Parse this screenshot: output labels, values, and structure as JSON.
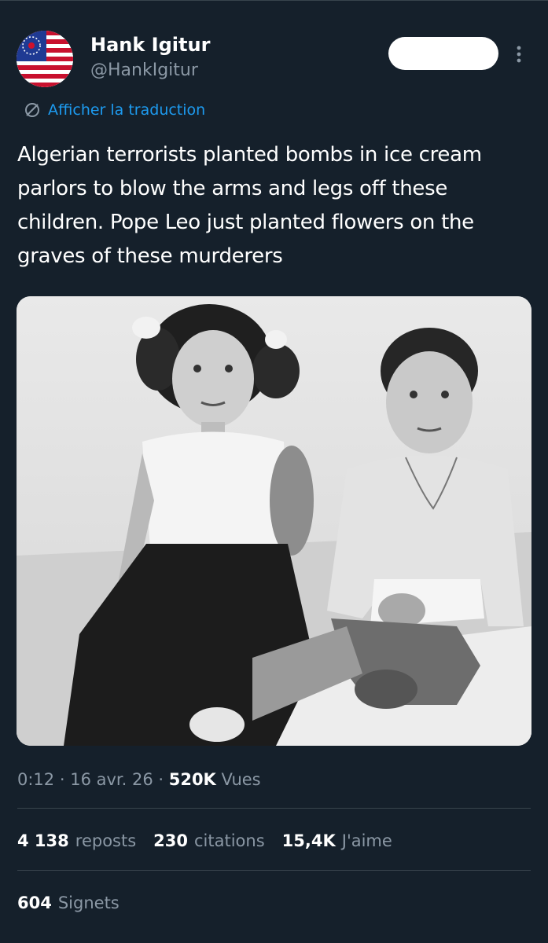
{
  "author": {
    "name": "Hank Igitur",
    "handle": "@HankIgitur"
  },
  "follow_button_label": "",
  "translate_link": "Afficher la traduction",
  "tweet_text": "Algerian terrorists planted bombs in ice cream parlors to blow the arms and legs off these children. Pope Leo just planted flowers on the graves of these murderers",
  "meta": {
    "time": "0:12",
    "separator": " · ",
    "date": "16 avr. 26",
    "views_count": "520K",
    "views_label": "Vues"
  },
  "stats": {
    "reposts": {
      "count": "4 138",
      "label": "reposts"
    },
    "quotes": {
      "count": "230",
      "label": "citations"
    },
    "likes": {
      "count": "15,4K",
      "label": "J'aime"
    }
  },
  "bookmarks": {
    "count": "604",
    "label": "Signets"
  },
  "icons": {
    "avatar": "us-flag-avatar",
    "translate": "translate-slash-circle-icon",
    "more": "more-vertical-icon"
  },
  "colors": {
    "background": "#15202b",
    "accent": "#1d9bf0",
    "secondary_text": "#8b98a5",
    "divider": "#38444d"
  }
}
